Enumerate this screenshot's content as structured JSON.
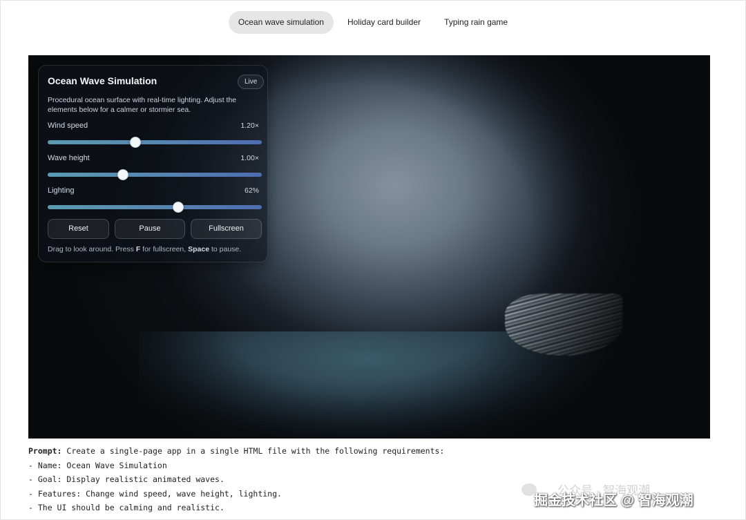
{
  "tabs": [
    {
      "label": "Ocean wave simulation",
      "active": true
    },
    {
      "label": "Holiday card builder",
      "active": false
    },
    {
      "label": "Typing rain game",
      "active": false
    }
  ],
  "panel": {
    "title": "Ocean Wave Simulation",
    "badge": "Live",
    "description": "Procedural ocean surface with real-time lighting. Adjust the elements below for a calmer or stormier sea.",
    "controls": [
      {
        "label": "Wind speed",
        "value_text": "1.20×",
        "fraction": 0.41
      },
      {
        "label": "Wave height",
        "value_text": "1.00×",
        "fraction": 0.35
      },
      {
        "label": "Lighting",
        "value_text": "62%",
        "fraction": 0.61
      }
    ],
    "buttons": {
      "reset": "Reset",
      "pause": "Pause",
      "fullscreen": "Fullscreen"
    },
    "hint": {
      "p1": "Drag to look around. Press ",
      "key1": "F",
      "p2": " for fullscreen, ",
      "key2": "Space",
      "p3": " to pause."
    }
  },
  "prompt": {
    "label": "Prompt:",
    "first_line": " Create a single-page app in a single HTML file with the following requirements:",
    "lines": [
      "- Name: Ocean Wave Simulation",
      "- Goal: Display realistic animated waves.",
      "- Features: Change wind speed, wave height, lighting.",
      "- The UI should be calming and realistic."
    ]
  },
  "watermark": {
    "top_text": "公众号 · 智海观潮",
    "main_text": "掘金技术社区 @ 智海观潮"
  },
  "colors": {
    "slider_start": "#5b9bb1",
    "slider_end": "#4e6db2",
    "active_tab_bg": "#e6e6e6"
  }
}
